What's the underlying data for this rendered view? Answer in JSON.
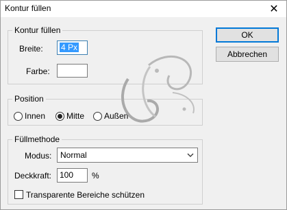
{
  "window": {
    "title": "Kontur füllen",
    "close_glyph": "✕"
  },
  "stroke_group": {
    "title": "Kontur füllen",
    "width_label": "Breite:",
    "width_value": "4 Px",
    "color_label": "Farbe:",
    "color_value": "#ffffff"
  },
  "position_group": {
    "title": "Position",
    "options": [
      {
        "label": "Innen",
        "checked": false
      },
      {
        "label": "Mitte",
        "checked": true
      },
      {
        "label": "Außen",
        "checked": false
      }
    ]
  },
  "blend_group": {
    "title": "Füllmethode",
    "mode_label": "Modus:",
    "mode_value": "Normal",
    "opacity_label": "Deckkraft:",
    "opacity_value": "100",
    "opacity_unit": "%",
    "preserve_label": "Transparente Bereiche schützen",
    "preserve_checked": false
  },
  "buttons": {
    "ok": "OK",
    "cancel": "Abbrechen"
  },
  "colors": {
    "accent": "#0078d7",
    "selection": "#3399ff"
  }
}
